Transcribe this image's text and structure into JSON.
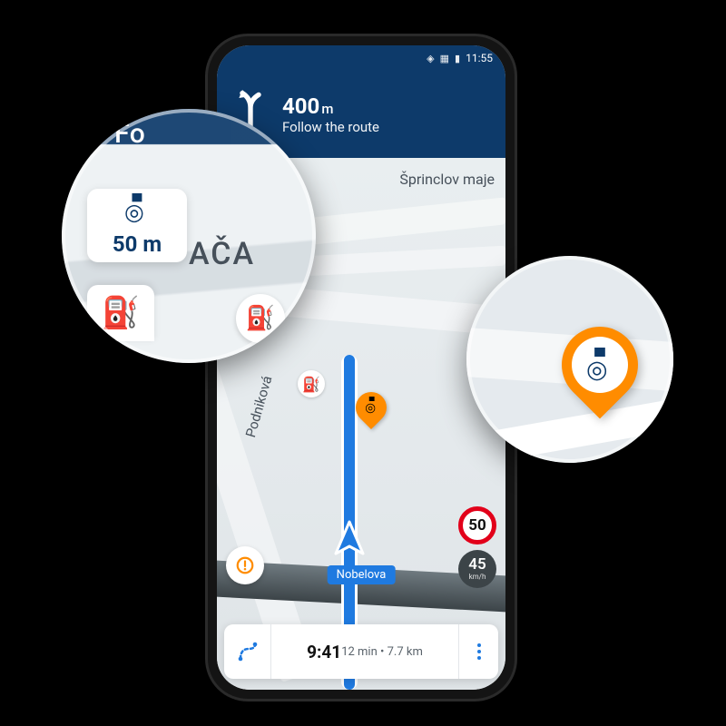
{
  "statusbar": {
    "time": "11:55"
  },
  "nav": {
    "distance_value": "400",
    "distance_unit": "m",
    "instruction": "Follow the route"
  },
  "map": {
    "label_top": "Šprinclov maje",
    "label_street_vertical": "Podniková",
    "current_street": "Nobelova"
  },
  "speed": {
    "limit": "50",
    "current": "45",
    "unit": "km/h"
  },
  "bottom": {
    "eta": "9:41",
    "duration": "12 min",
    "distance": "7.7 km",
    "sep": " • "
  },
  "zoom_left": {
    "header_fragment": "Fo",
    "camera_distance": "50 m",
    "street_fragment": "AČA"
  },
  "colors": {
    "brand_blue": "#0d3a6a",
    "route_blue": "#1f7ae0",
    "alert_orange": "#ff8c00",
    "limit_red": "#e2001a"
  }
}
